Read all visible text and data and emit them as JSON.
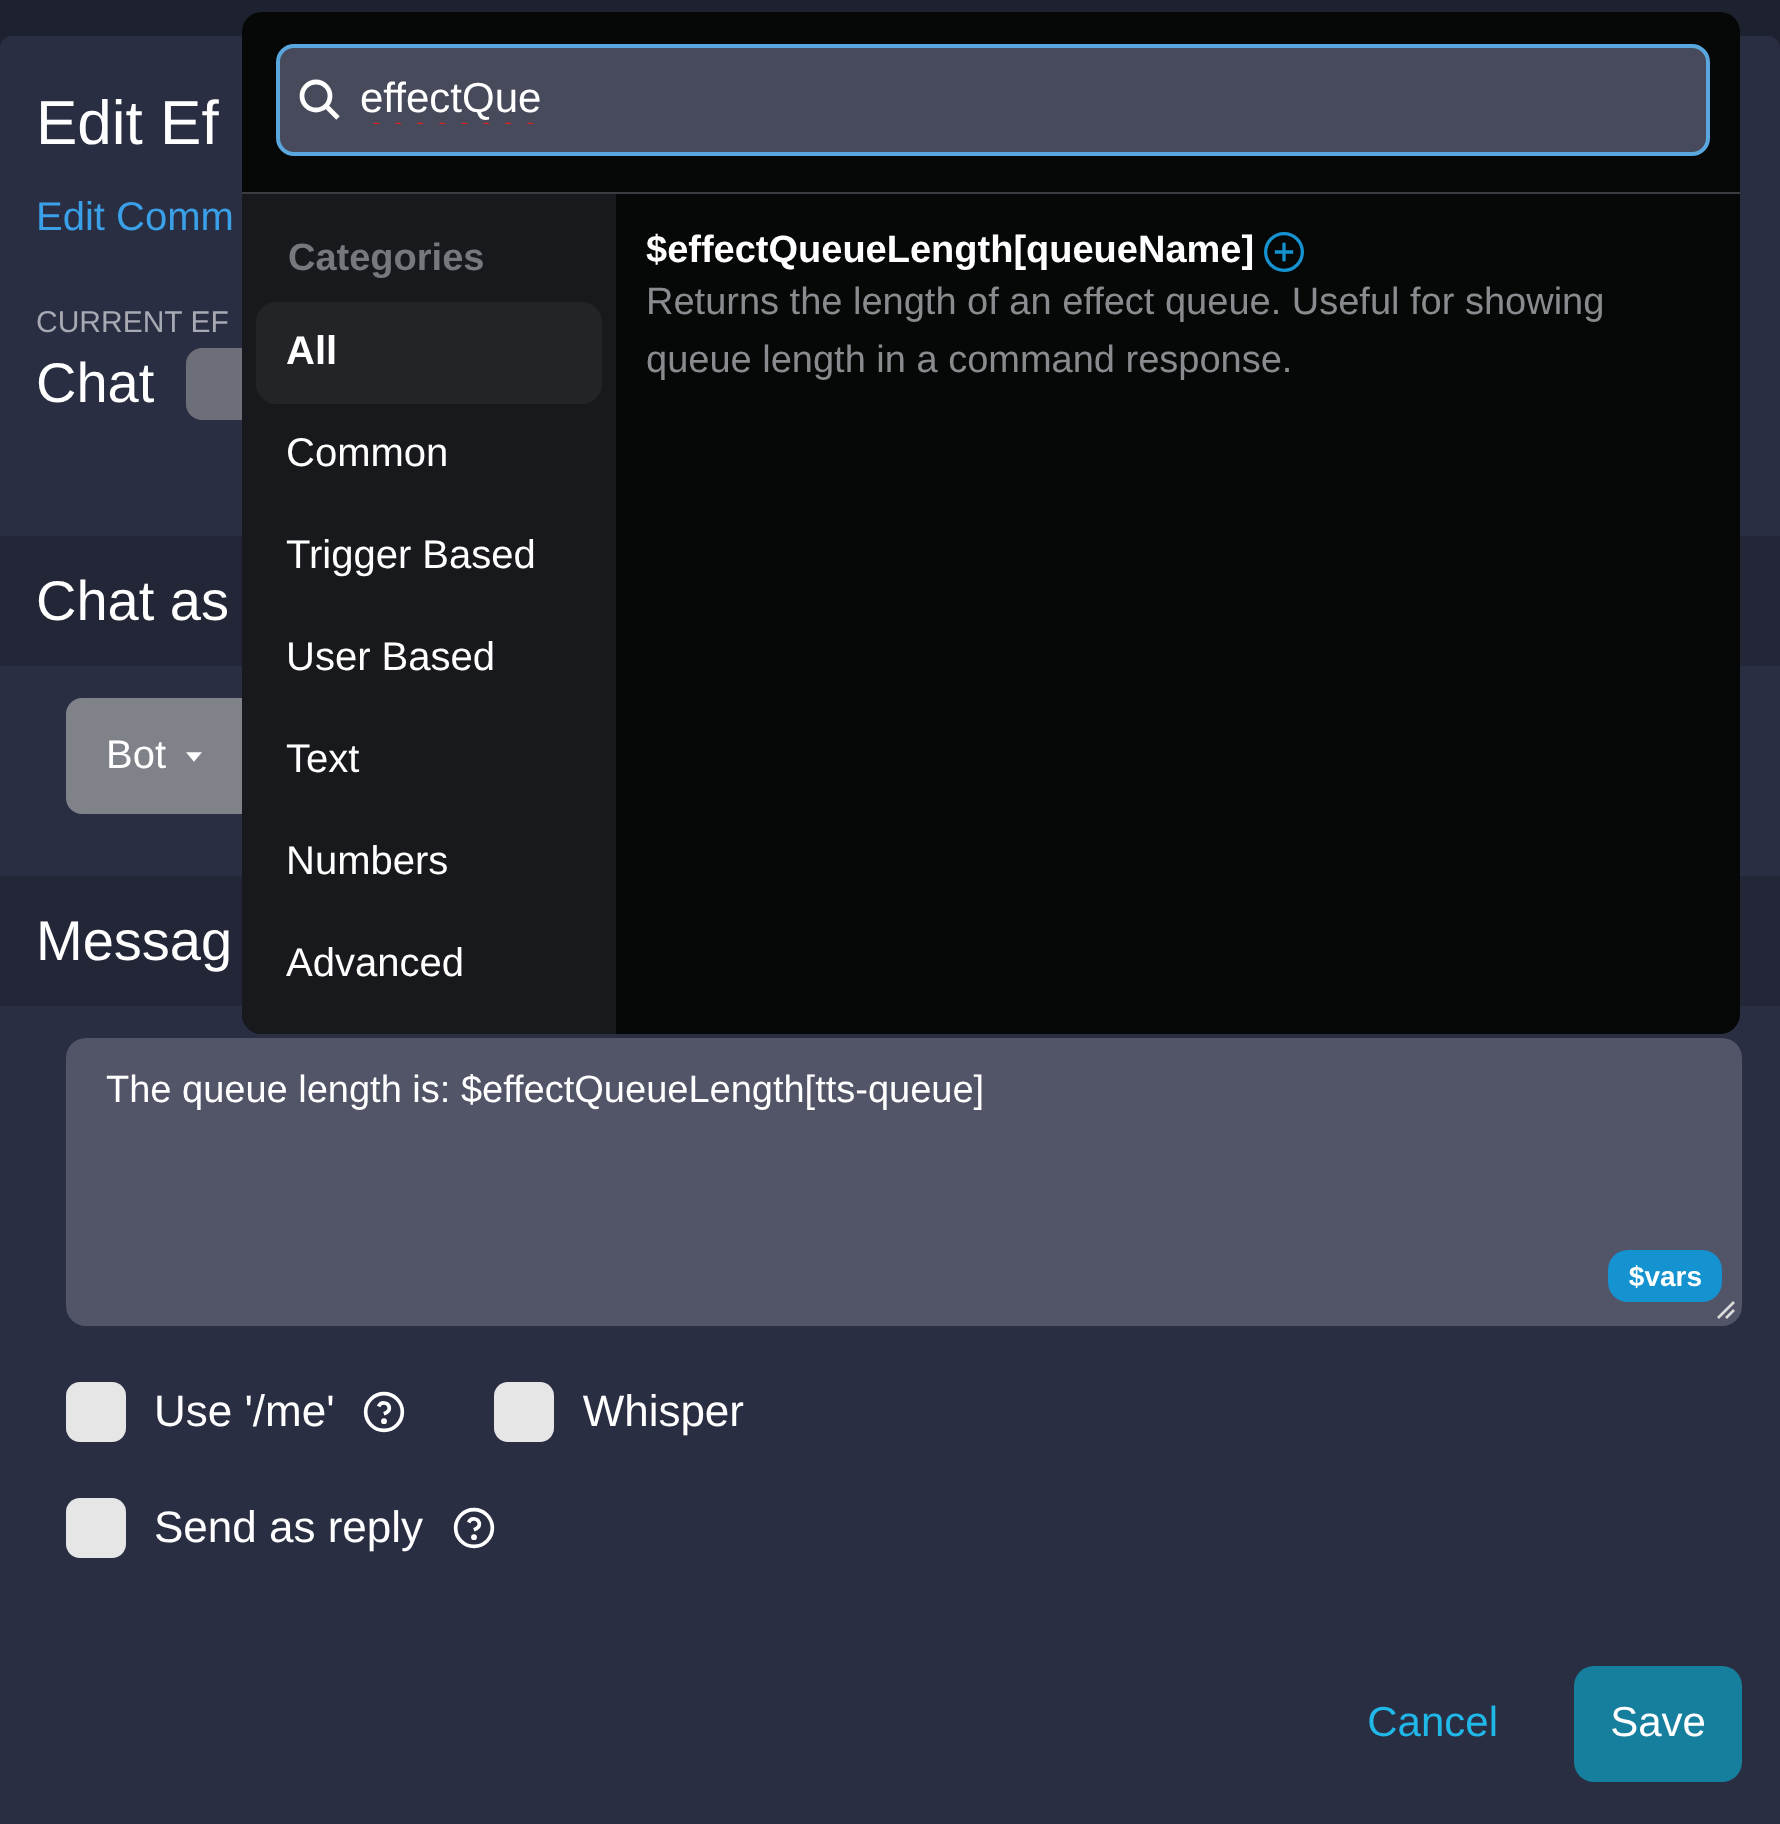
{
  "modal": {
    "title": "Edit Ef",
    "breadcrumb_link": "Edit Comm",
    "current_effect_label": "CURRENT EF",
    "current_effect": "Chat"
  },
  "chat_as": {
    "heading": "Chat as",
    "dropdown": "Bot"
  },
  "message": {
    "heading": "Messag",
    "value": "The queue length is: $effectQueueLength[tts-queue]",
    "vars_button": "$vars"
  },
  "options": [
    {
      "label": "Use '/me'",
      "checked": false,
      "help": true
    },
    {
      "label": "Whisper",
      "checked": false,
      "help": false
    },
    {
      "label": "Send as reply",
      "checked": false,
      "help": true
    }
  ],
  "buttons": {
    "cancel": "Cancel",
    "save": "Save"
  },
  "variable_picker": {
    "search": "effectQue",
    "categories_heading": "Categories",
    "categories": [
      {
        "label": "All",
        "selected": true
      },
      {
        "label": "Common",
        "selected": false
      },
      {
        "label": "Trigger Based",
        "selected": false
      },
      {
        "label": "User Based",
        "selected": false
      },
      {
        "label": "Text",
        "selected": false
      },
      {
        "label": "Numbers",
        "selected": false
      },
      {
        "label": "Advanced",
        "selected": false
      }
    ],
    "results": [
      {
        "name": "$effectQueueLength[queueName]",
        "description": "Returns the length of an effect queue. Useful for showing queue length in a command response."
      }
    ]
  }
}
